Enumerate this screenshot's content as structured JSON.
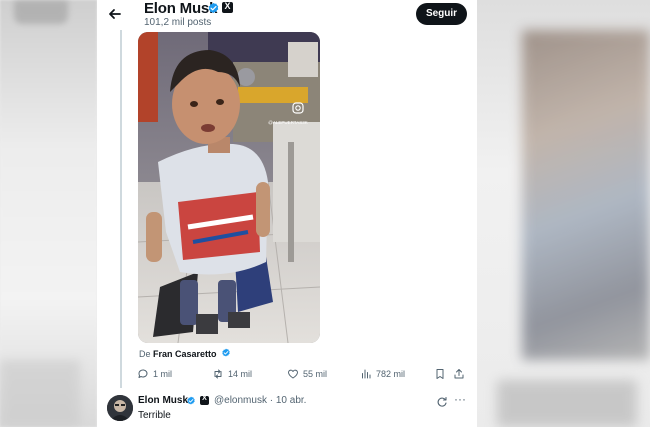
{
  "header": {
    "title": "Elon Musk",
    "posts_count": "101,2 mil posts",
    "follow_label": "Seguir"
  },
  "media": {
    "watermark": "@ALEPUERTAS3K"
  },
  "quote": {
    "prefix": "De",
    "author": "Fran Casaretto"
  },
  "actions": {
    "replies": "1 mil",
    "reposts": "14 mil",
    "likes": "55 mil",
    "views": "782 mil"
  },
  "reply": {
    "name": "Elon Musk",
    "handle": "@elonmusk",
    "separator": "·",
    "date": "10 abr.",
    "text": "Terrible",
    "more": "···"
  },
  "icons": {
    "back": "arrow-left-icon",
    "verified": "verified-badge-icon",
    "affiliate": "x-logo-icon",
    "reply": "comment-icon",
    "repost": "repost-icon",
    "like": "heart-icon",
    "views": "bar-chart-icon",
    "bookmark": "bookmark-icon",
    "share": "share-icon",
    "grok": "grok-icon"
  },
  "colors": {
    "verified_blue": "#1d9bf0",
    "text_primary": "#0f1419",
    "text_secondary": "#536471",
    "button_dark": "#0f1419"
  }
}
